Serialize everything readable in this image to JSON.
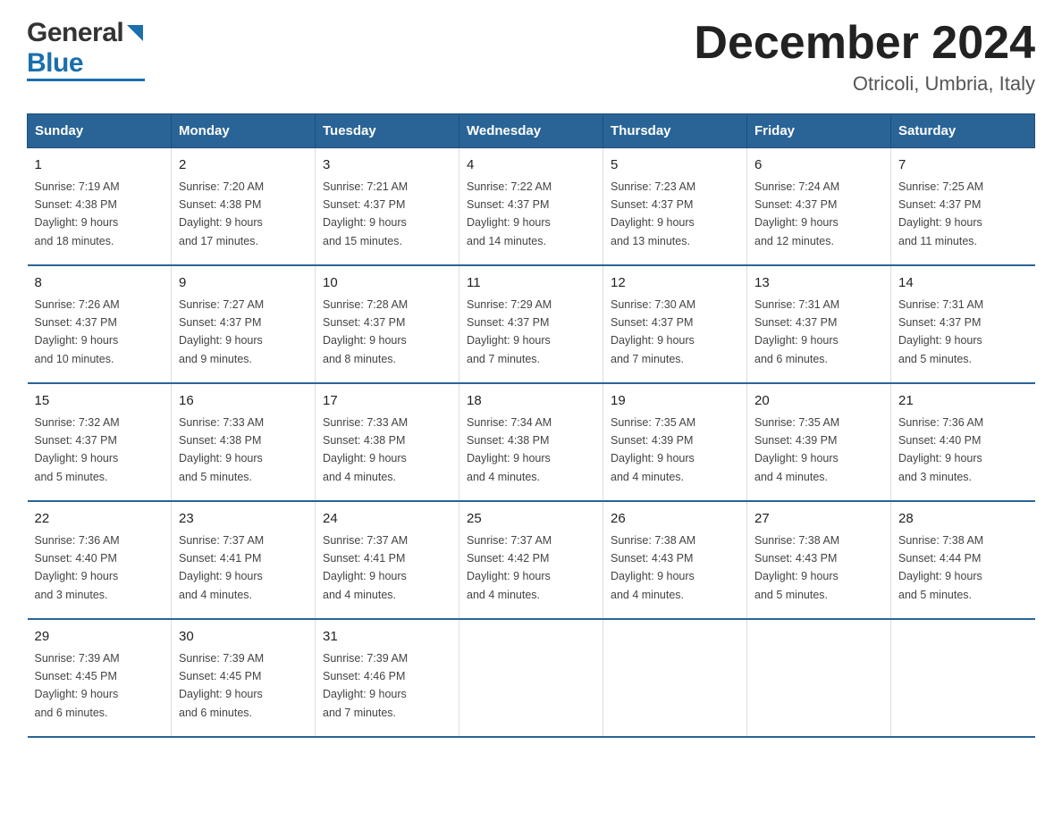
{
  "header": {
    "logo_general": "General",
    "logo_blue": "Blue",
    "main_title": "December 2024",
    "subtitle": "Otricoli, Umbria, Italy"
  },
  "calendar": {
    "days_of_week": [
      "Sunday",
      "Monday",
      "Tuesday",
      "Wednesday",
      "Thursday",
      "Friday",
      "Saturday"
    ],
    "weeks": [
      [
        {
          "day": "1",
          "sunrise": "7:19 AM",
          "sunset": "4:38 PM",
          "daylight": "9 hours and 18 minutes."
        },
        {
          "day": "2",
          "sunrise": "7:20 AM",
          "sunset": "4:38 PM",
          "daylight": "9 hours and 17 minutes."
        },
        {
          "day": "3",
          "sunrise": "7:21 AM",
          "sunset": "4:37 PM",
          "daylight": "9 hours and 15 minutes."
        },
        {
          "day": "4",
          "sunrise": "7:22 AM",
          "sunset": "4:37 PM",
          "daylight": "9 hours and 14 minutes."
        },
        {
          "day": "5",
          "sunrise": "7:23 AM",
          "sunset": "4:37 PM",
          "daylight": "9 hours and 13 minutes."
        },
        {
          "day": "6",
          "sunrise": "7:24 AM",
          "sunset": "4:37 PM",
          "daylight": "9 hours and 12 minutes."
        },
        {
          "day": "7",
          "sunrise": "7:25 AM",
          "sunset": "4:37 PM",
          "daylight": "9 hours and 11 minutes."
        }
      ],
      [
        {
          "day": "8",
          "sunrise": "7:26 AM",
          "sunset": "4:37 PM",
          "daylight": "9 hours and 10 minutes."
        },
        {
          "day": "9",
          "sunrise": "7:27 AM",
          "sunset": "4:37 PM",
          "daylight": "9 hours and 9 minutes."
        },
        {
          "day": "10",
          "sunrise": "7:28 AM",
          "sunset": "4:37 PM",
          "daylight": "9 hours and 8 minutes."
        },
        {
          "day": "11",
          "sunrise": "7:29 AM",
          "sunset": "4:37 PM",
          "daylight": "9 hours and 7 minutes."
        },
        {
          "day": "12",
          "sunrise": "7:30 AM",
          "sunset": "4:37 PM",
          "daylight": "9 hours and 7 minutes."
        },
        {
          "day": "13",
          "sunrise": "7:31 AM",
          "sunset": "4:37 PM",
          "daylight": "9 hours and 6 minutes."
        },
        {
          "day": "14",
          "sunrise": "7:31 AM",
          "sunset": "4:37 PM",
          "daylight": "9 hours and 5 minutes."
        }
      ],
      [
        {
          "day": "15",
          "sunrise": "7:32 AM",
          "sunset": "4:37 PM",
          "daylight": "9 hours and 5 minutes."
        },
        {
          "day": "16",
          "sunrise": "7:33 AM",
          "sunset": "4:38 PM",
          "daylight": "9 hours and 5 minutes."
        },
        {
          "day": "17",
          "sunrise": "7:33 AM",
          "sunset": "4:38 PM",
          "daylight": "9 hours and 4 minutes."
        },
        {
          "day": "18",
          "sunrise": "7:34 AM",
          "sunset": "4:38 PM",
          "daylight": "9 hours and 4 minutes."
        },
        {
          "day": "19",
          "sunrise": "7:35 AM",
          "sunset": "4:39 PM",
          "daylight": "9 hours and 4 minutes."
        },
        {
          "day": "20",
          "sunrise": "7:35 AM",
          "sunset": "4:39 PM",
          "daylight": "9 hours and 4 minutes."
        },
        {
          "day": "21",
          "sunrise": "7:36 AM",
          "sunset": "4:40 PM",
          "daylight": "9 hours and 3 minutes."
        }
      ],
      [
        {
          "day": "22",
          "sunrise": "7:36 AM",
          "sunset": "4:40 PM",
          "daylight": "9 hours and 3 minutes."
        },
        {
          "day": "23",
          "sunrise": "7:37 AM",
          "sunset": "4:41 PM",
          "daylight": "9 hours and 4 minutes."
        },
        {
          "day": "24",
          "sunrise": "7:37 AM",
          "sunset": "4:41 PM",
          "daylight": "9 hours and 4 minutes."
        },
        {
          "day": "25",
          "sunrise": "7:37 AM",
          "sunset": "4:42 PM",
          "daylight": "9 hours and 4 minutes."
        },
        {
          "day": "26",
          "sunrise": "7:38 AM",
          "sunset": "4:43 PM",
          "daylight": "9 hours and 4 minutes."
        },
        {
          "day": "27",
          "sunrise": "7:38 AM",
          "sunset": "4:43 PM",
          "daylight": "9 hours and 5 minutes."
        },
        {
          "day": "28",
          "sunrise": "7:38 AM",
          "sunset": "4:44 PM",
          "daylight": "9 hours and 5 minutes."
        }
      ],
      [
        {
          "day": "29",
          "sunrise": "7:39 AM",
          "sunset": "4:45 PM",
          "daylight": "9 hours and 6 minutes."
        },
        {
          "day": "30",
          "sunrise": "7:39 AM",
          "sunset": "4:45 PM",
          "daylight": "9 hours and 6 minutes."
        },
        {
          "day": "31",
          "sunrise": "7:39 AM",
          "sunset": "4:46 PM",
          "daylight": "9 hours and 7 minutes."
        },
        {
          "day": "",
          "sunrise": "",
          "sunset": "",
          "daylight": ""
        },
        {
          "day": "",
          "sunrise": "",
          "sunset": "",
          "daylight": ""
        },
        {
          "day": "",
          "sunrise": "",
          "sunset": "",
          "daylight": ""
        },
        {
          "day": "",
          "sunrise": "",
          "sunset": "",
          "daylight": ""
        }
      ]
    ],
    "labels": {
      "sunrise": "Sunrise:",
      "sunset": "Sunset:",
      "daylight": "Daylight:"
    }
  }
}
